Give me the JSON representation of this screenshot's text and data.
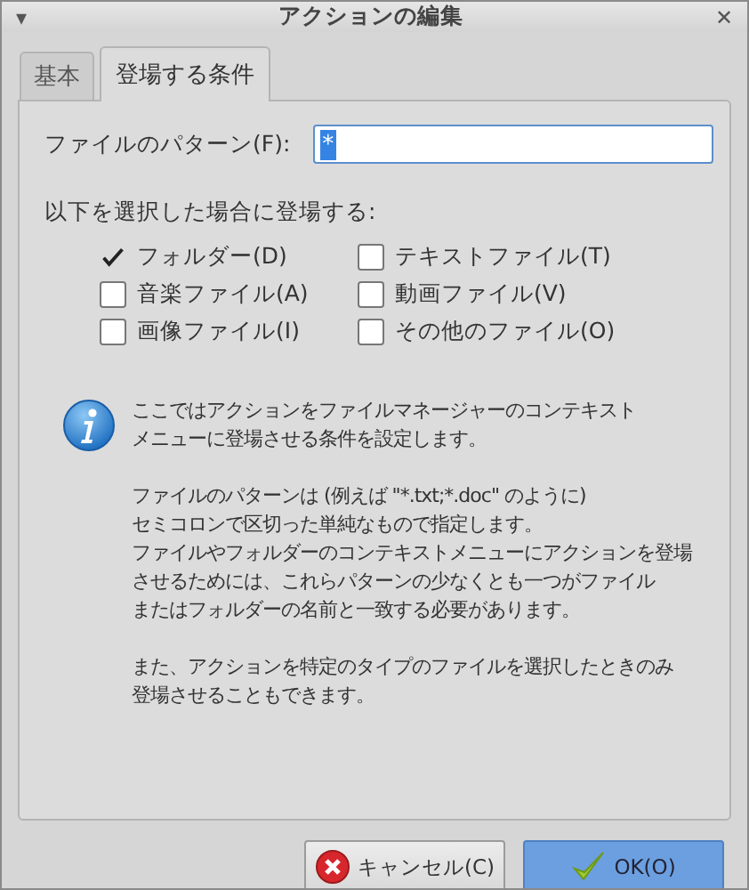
{
  "window": {
    "title": "アクションの編集",
    "menu_glyph": "▾",
    "close_glyph": "✕"
  },
  "tabs": [
    {
      "label": "基本",
      "selected": false
    },
    {
      "label": "登場する条件",
      "selected": true
    }
  ],
  "pattern": {
    "label": "ファイルのパターン(F):",
    "value": "*"
  },
  "conditions": {
    "label": "以下を選択した場合に登場する:",
    "options": [
      {
        "label": "フォルダー(D)",
        "checked": true
      },
      {
        "label": "テキストファイル(T)",
        "checked": false
      },
      {
        "label": "音楽ファイル(A)",
        "checked": false
      },
      {
        "label": "動画ファイル(V)",
        "checked": false
      },
      {
        "label": "画像ファイル(I)",
        "checked": false
      },
      {
        "label": "その他のファイル(O)",
        "checked": false
      }
    ]
  },
  "info": {
    "paragraphs": [
      [
        "ここではアクションをファイルマネージャーのコンテキスト",
        "メニューに登場させる条件を設定します。"
      ],
      [
        "ファイルのパターンは (例えば \"*.txt;*.doc\" のように)",
        "セミコロンで区切った単純なもので指定します。",
        "ファイルやフォルダーのコンテキストメニューにアクションを登場",
        "させるためには、これらパターンの少なくとも一つがファイル",
        "またはフォルダーの名前と一致する必要があります。"
      ],
      [
        "また、アクションを特定のタイプのファイルを選択したときのみ",
        "登場させることもできます。"
      ]
    ]
  },
  "buttons": [
    {
      "label": "キャンセル(C)",
      "kind": "cancel"
    },
    {
      "label": "OK(O)",
      "kind": "ok"
    }
  ]
}
